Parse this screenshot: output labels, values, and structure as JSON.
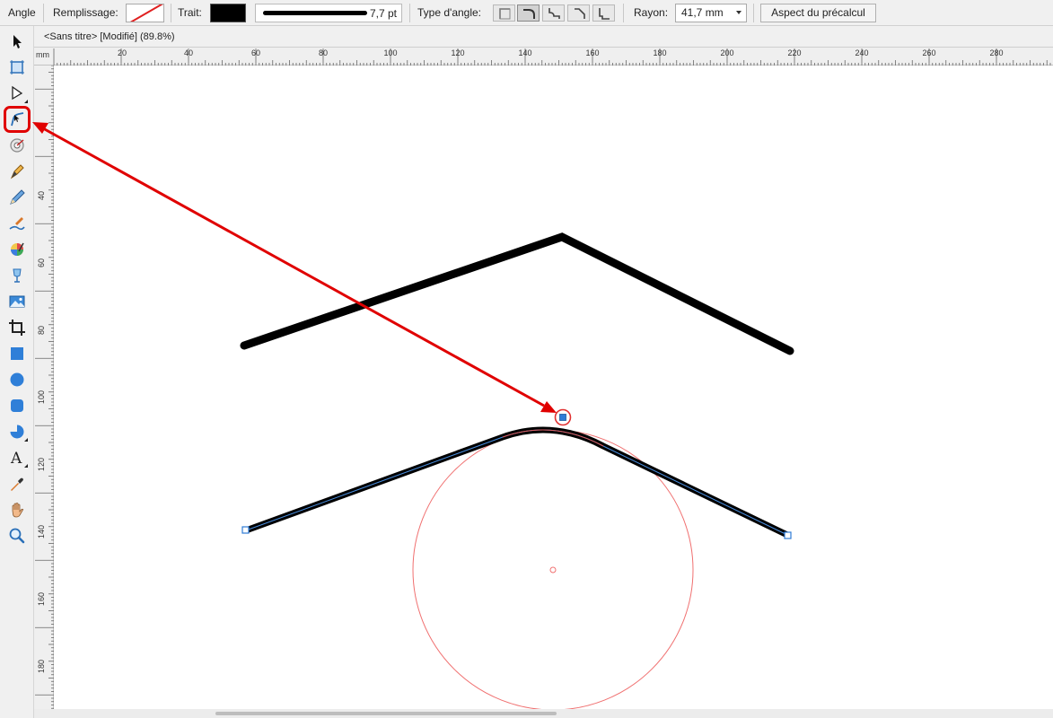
{
  "toolbar": {
    "tool_name": "Angle",
    "fill_label": "Remplissage:",
    "stroke_label": "Trait:",
    "stroke_width": "7,7 pt",
    "corner_type_label": "Type d'angle:",
    "corner_types": [
      "none",
      "round",
      "concave",
      "straight",
      "stepped"
    ],
    "corner_type_selected": "round",
    "radius_label": "Rayon:",
    "radius_value": "41,7 mm",
    "preview_button": "Aspect du précalcul"
  },
  "document": {
    "tab_title": "<Sans titre> [Modifié] (89.8%)"
  },
  "ruler": {
    "unit": "mm",
    "horizontal_labels": [
      "20",
      "40",
      "60",
      "80",
      "100",
      "120",
      "140",
      "160",
      "180",
      "200",
      "220",
      "240",
      "260",
      "280"
    ],
    "vertical_labels": [
      "40",
      "60",
      "80",
      "100",
      "120",
      "140",
      "160",
      "180"
    ]
  },
  "tools": [
    "move-tool-icon",
    "artboard-tool-icon",
    "node-tool-icon",
    "corner-tool-icon",
    "point-transform-tool-icon",
    "pen-tool-icon",
    "pencil-tool-icon",
    "vector-brush-tool-icon",
    "fill-tool-icon",
    "transparency-tool-icon",
    "place-image-tool-icon",
    "crop-tool-icon",
    "rectangle-tool-icon",
    "ellipse-tool-icon",
    "rounded-rectangle-tool-icon",
    "pie-tool-icon",
    "text-tool-icon",
    "color-picker-tool-icon",
    "view-tool-icon",
    "zoom-tool-icon"
  ],
  "colors": {
    "annotation": "#e00000",
    "selection": "#2e7bd6",
    "guide_circle": "#f07070"
  }
}
